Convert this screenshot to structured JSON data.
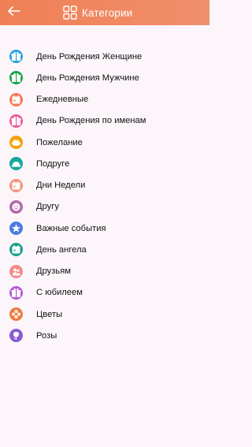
{
  "colors": {
    "app_bar_start": "#f07f55",
    "app_bar_end": "#ef8f6c",
    "background": "#fcf6fb"
  },
  "app_bar": {
    "title": "Категории",
    "back_icon": "arrow-left-icon",
    "title_icon": "grid-four-squares-icon"
  },
  "categories": [
    {
      "label": "День Рождения Женщине",
      "icon": "gift-icon",
      "color": "#2aa0e2"
    },
    {
      "label": "День Рождения Мужчине",
      "icon": "gift-icon",
      "color": "#19a44a"
    },
    {
      "label": "Ежедневные",
      "icon": "calendar-icon",
      "color": "#f47a55"
    },
    {
      "label": "День Рождения по именам",
      "icon": "gift-icon",
      "color": "#ec5b9b"
    },
    {
      "label": "Пожелание",
      "icon": "cloud-icon",
      "color": "#f6a20c"
    },
    {
      "label": "Подруге",
      "icon": "dome-icon",
      "color": "#17a89e"
    },
    {
      "label": "Дни Недели",
      "icon": "calendar-icon",
      "color": "#f4937a"
    },
    {
      "label": "Другу",
      "icon": "smile-icon",
      "color": "#b26aa8"
    },
    {
      "label": "Важные события",
      "icon": "star-icon",
      "color": "#4d7ce0"
    },
    {
      "label": "День ангела",
      "icon": "calendar-icon",
      "color": "#1a9f8d"
    },
    {
      "label": "Друзьям",
      "icon": "people-icon",
      "color": "#f28b8b"
    },
    {
      "label": "С юбилеем",
      "icon": "gift-icon",
      "color": "#b454d8"
    },
    {
      "label": "Цветы",
      "icon": "flower-icon",
      "color": "#f27a3c"
    },
    {
      "label": "Розы",
      "icon": "rose-icon",
      "color": "#8a5bd2"
    }
  ]
}
